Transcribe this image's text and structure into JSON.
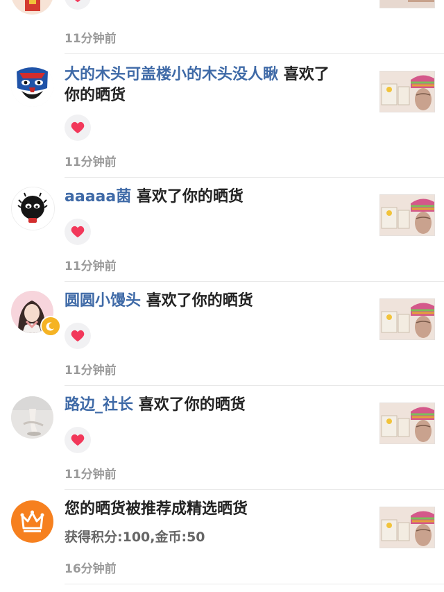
{
  "feed": {
    "items": [
      {
        "time": "11分钟前"
      },
      {
        "user": "大的木头可盖楼小的木头没人瞅",
        "action": "喜欢了",
        "action_wrap": "你的晒货",
        "time": "11分钟前"
      },
      {
        "user": "aaaaa菌",
        "action": "喜欢了你的晒货",
        "time": "11分钟前"
      },
      {
        "user": "圆圆小馒头",
        "action": "喜欢了你的晒货",
        "time": "11分钟前"
      },
      {
        "user": "路边_社长",
        "action": "喜欢了你的晒货",
        "time": "11分钟前"
      },
      {
        "title": "您的晒货被推荐成精选晒货",
        "subtitle": "获得积分:100,金币:50",
        "time": "16分钟前"
      }
    ]
  },
  "colors": {
    "username": "#3f6aa7",
    "heart": "#f2385a",
    "crown_bg": "#f6801f",
    "moon_badge": "#f5b324"
  },
  "icons": [
    "heart-icon",
    "crown-icon",
    "moon-badge-icon"
  ]
}
